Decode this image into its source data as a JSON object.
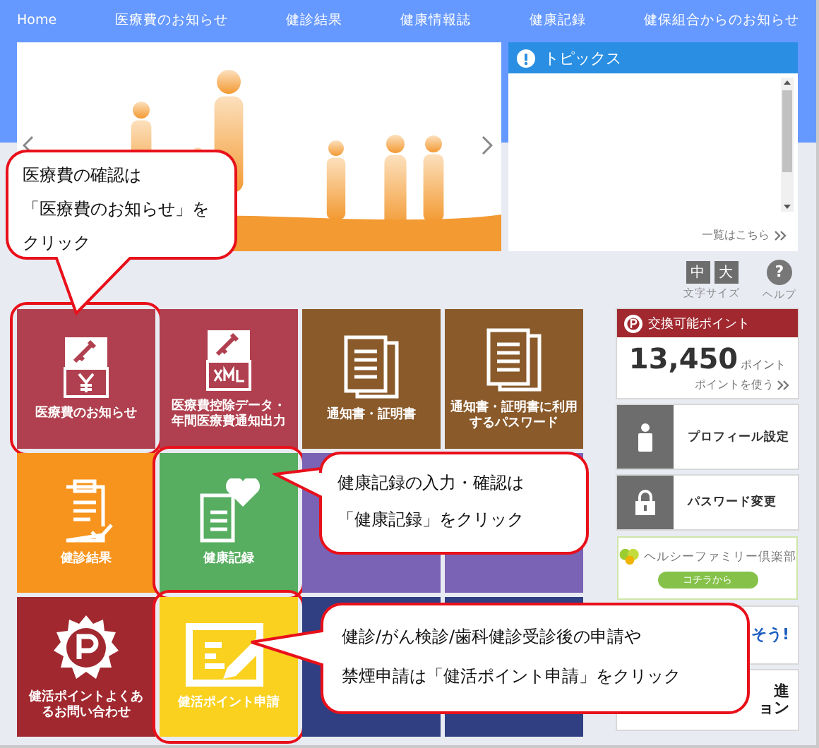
{
  "nav": [
    "Home",
    "医療費のお知らせ",
    "健診結果",
    "健康情報誌",
    "健康記録",
    "健保組合からのお知らせ"
  ],
  "topics": {
    "title": "トピックス",
    "more": "一覧はこちら"
  },
  "font_size": {
    "label": "文字サイズ",
    "options": [
      "中",
      "大"
    ]
  },
  "help": {
    "symbol": "?",
    "label": "ヘルプ"
  },
  "tiles": [
    {
      "kind": "yen",
      "lines": [
        "医療費のお知らせ"
      ],
      "color": "#b0404f",
      "highlighted": true
    },
    {
      "kind": "xml",
      "lines": [
        "医療費控除データ・",
        "年間医療費通知出力"
      ],
      "color": "#b0404f",
      "highlighted": false
    },
    {
      "kind": "docs",
      "lines": [
        "通知書・証明書"
      ],
      "color": "#8a5a2b",
      "highlighted": false
    },
    {
      "kind": "docs",
      "lines": [
        "通知書・証明書に利用",
        "するパスワード"
      ],
      "color": "#8a5a2b",
      "highlighted": false
    },
    {
      "kind": "clipboard",
      "lines": [
        "健診結果"
      ],
      "color": "#f7941d",
      "highlighted": false
    },
    {
      "kind": "heart",
      "lines": [
        "健康記録"
      ],
      "color": "#57ad60",
      "highlighted": true
    },
    {
      "kind": "none",
      "color": "#7a62b5",
      "highlighted": false
    },
    {
      "kind": "none",
      "color": "#7a62b5",
      "highlighted": false
    },
    {
      "kind": "point",
      "lines": [
        "健活ポイントよくあ",
        "るお問い合わせ"
      ],
      "color": "#a1282f",
      "highlighted": false
    },
    {
      "kind": "form",
      "lines": [
        "健活ポイント申請"
      ],
      "color": "#f9d11e",
      "highlighted": true
    },
    {
      "kind": "none",
      "color": "#2f3f82",
      "highlighted": false
    },
    {
      "kind": "none",
      "color": "#2f3f82",
      "highlighted": false
    }
  ],
  "points": {
    "title": "交換可能ポイント",
    "value": "13,450",
    "unit": "ポイント",
    "link": "ポイントを使う"
  },
  "sidebar_links": [
    {
      "kind": "profile",
      "label": "プロフィール設定"
    },
    {
      "kind": "password",
      "label": "パスワード変更"
    }
  ],
  "banner": {
    "title": "ヘルシーファミリー倶楽部",
    "button": "コチラから"
  },
  "cards": [
    {
      "lines": [
        "そう!"
      ]
    },
    {
      "lines": [
        "進",
        "ョン"
      ]
    }
  ],
  "callouts": [
    {
      "lines": [
        "医療費の確認は",
        "「医療費のお知らせ」を",
        "クリック"
      ]
    },
    {
      "lines": [
        "健康記録の入力・確認は",
        "「健康記録」をクリック"
      ]
    },
    {
      "lines": [
        "健診/がん検診/歯科健診受診後の申請や",
        "禁煙申請は「健活ポイント申請」をクリック"
      ]
    }
  ]
}
